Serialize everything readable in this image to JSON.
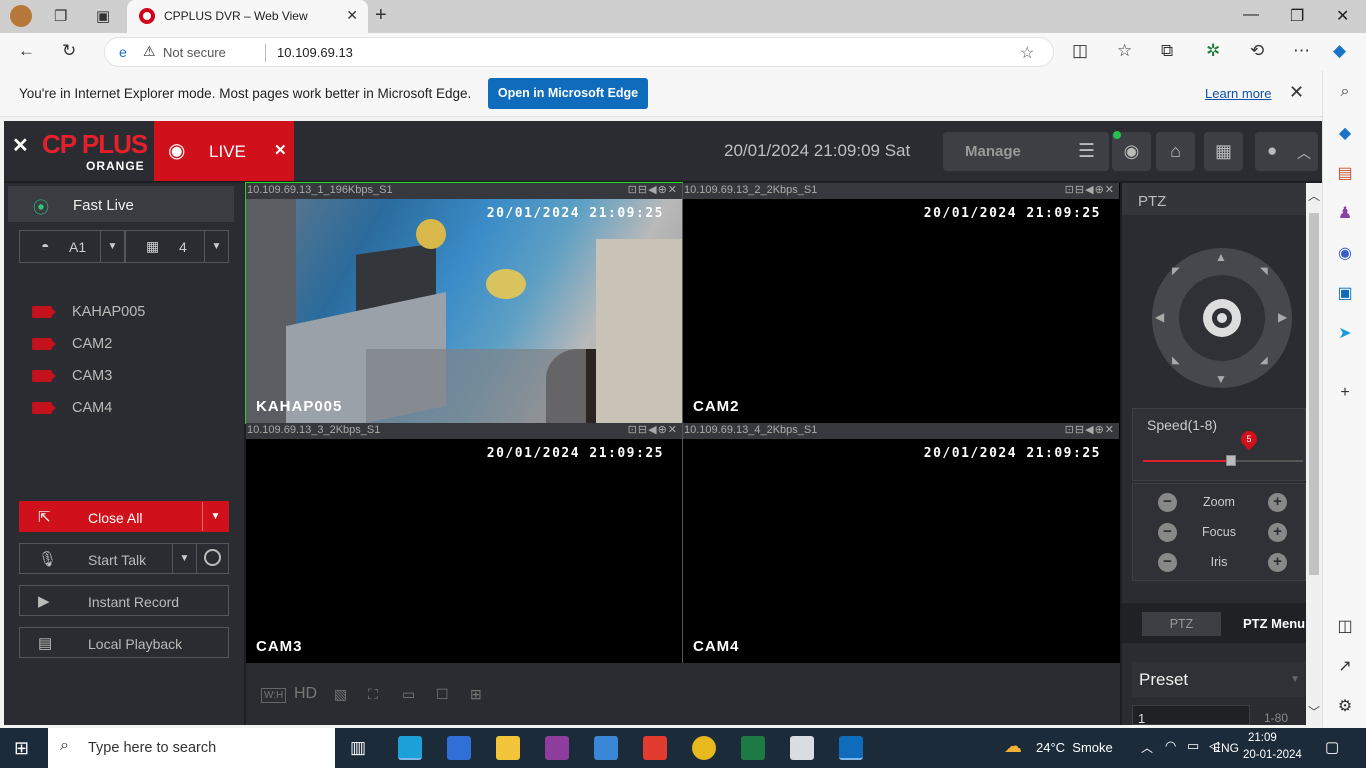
{
  "browser": {
    "tab_title": "CPPLUS DVR – Web View",
    "not_secure": "Not secure",
    "url": "10.109.69.13",
    "ie_message": "You're in Internet Explorer mode. Most pages work better in Microsoft Edge.",
    "open_edge_label": "Open in Microsoft Edge",
    "learn_more": "Learn more"
  },
  "header": {
    "logo_text": "CP PLUS",
    "logo_sub": "ORANGE",
    "live_tab": "LIVE",
    "datetime": "20/01/2024 21:09:09 Sat",
    "manage_label": "Manage"
  },
  "left": {
    "fast_live": "Fast Live",
    "area_select": "A1",
    "split_select": "4",
    "cameras": [
      {
        "label": "KAHAP005"
      },
      {
        "label": "CAM2"
      },
      {
        "label": "CAM3"
      },
      {
        "label": "CAM4"
      }
    ],
    "close_all": "Close All",
    "start_talk": "Start Talk",
    "instant_record": "Instant Record",
    "local_playback": "Local Playback"
  },
  "grid": {
    "cells": [
      {
        "stream": "10.109.69.13_1_196Kbps_S1",
        "osd_time": "20/01/2024 21:09:25",
        "name": "KAHAP005"
      },
      {
        "stream": "10.109.69.13_2_2Kbps_S1",
        "osd_time": "20/01/2024 21:09:25",
        "name": "CAM2"
      },
      {
        "stream": "10.109.69.13_3_2Kbps_S1",
        "osd_time": "20/01/2024 21:09:25",
        "name": "CAM3"
      },
      {
        "stream": "10.109.69.13_4_2Kbps_S1",
        "osd_time": "20/01/2024 21:09:25",
        "name": "CAM4"
      }
    ],
    "bottom_hd_label": "HD",
    "bottom_wh_label": "W:H"
  },
  "ptz": {
    "title": "PTZ",
    "speed_label": "Speed(1-8)",
    "speed_value": "5",
    "speed_fraction": 0.55,
    "zoom": "Zoom",
    "focus": "Focus",
    "iris": "Iris",
    "tab_ptz": "PTZ",
    "tab_menu": "PTZ Menu",
    "preset_label": "Preset",
    "preset_value": "1",
    "preset_range": "1-80"
  },
  "taskbar": {
    "search_placeholder": "Type here to search",
    "weather": "24°C  Smoke",
    "lang": "ENG",
    "time": "21:09",
    "date": "20-01-2024"
  },
  "colors": {
    "brand_red": "#d0101b",
    "selected_green": "#1fdc1f",
    "edge_blue": "#0f6cbd"
  }
}
